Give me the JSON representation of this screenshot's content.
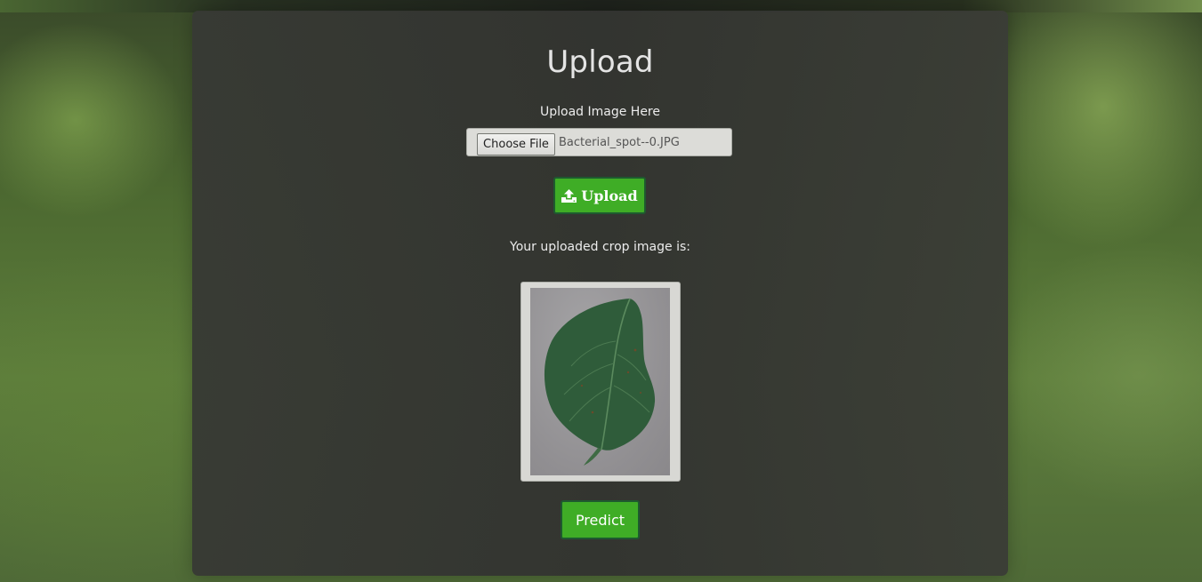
{
  "page": {
    "title": "Upload"
  },
  "upload_form": {
    "label": "Upload Image Here",
    "choose_file_label": "Choose File",
    "selected_file_name": "Bacterial_spot--0.JPG",
    "upload_button_label": "Upload",
    "upload_icon": "upload-icon"
  },
  "result": {
    "caption": "Your uploaded crop image is:",
    "image_subject": "leaf-image",
    "predict_button_label": "Predict"
  },
  "colors": {
    "button_green": "#3fad26",
    "button_border": "#1e5a2f",
    "panel_bg": "#353632",
    "text": "#ececec"
  }
}
